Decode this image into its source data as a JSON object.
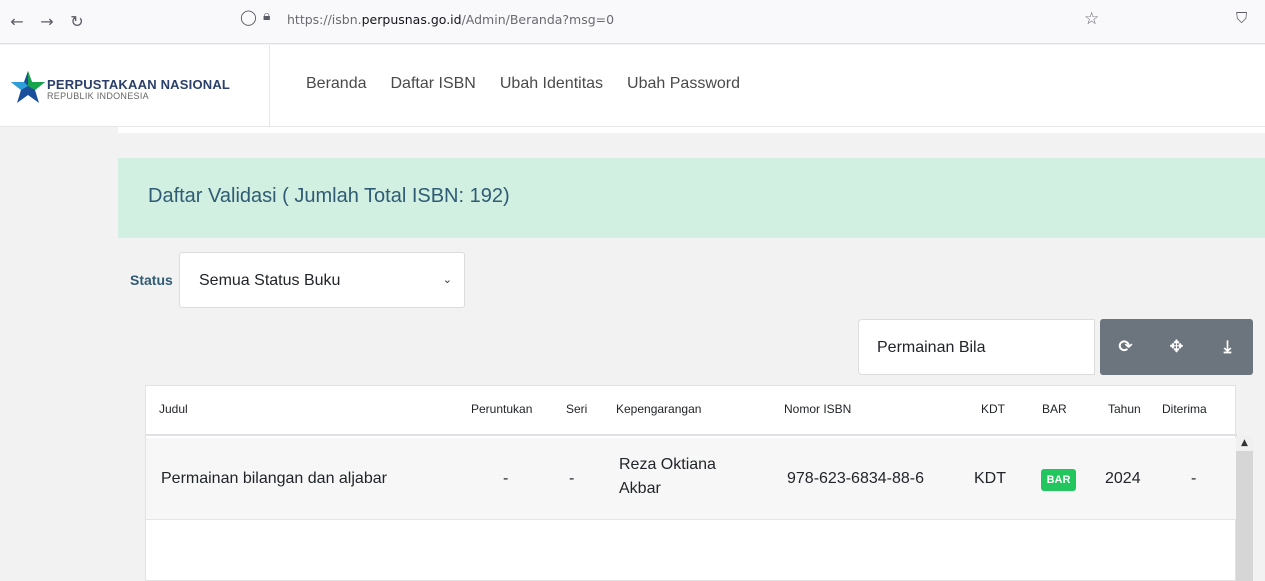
{
  "browser": {
    "url_prefix": "https://isbn.",
    "url_domain": "perpusnas.go.id",
    "url_path": "/Admin/Beranda?msg=0"
  },
  "brand": {
    "title": "PERPUSTAKAAN NASIONAL",
    "subtitle": "REPUBLIK INDONESIA"
  },
  "nav": {
    "items": [
      "Beranda",
      "Daftar ISBN",
      "Ubah Identitas",
      "Ubah Password"
    ]
  },
  "panel": {
    "title": "Daftar Validasi ( Jumlah Total ISBN: 192)"
  },
  "filter": {
    "status_label": "Status",
    "status_value": "Semua Status Buku"
  },
  "search": {
    "value": "Permainan Bila"
  },
  "table": {
    "headers": [
      "Judul",
      "Peruntukan",
      "Seri",
      "Kepengarangan",
      "Nomor ISBN",
      "KDT",
      "BAR",
      "Tahun",
      "Diterima"
    ],
    "rows": [
      {
        "judul": "Permainan bilangan dan aljabar",
        "peruntukan": "-",
        "seri": "-",
        "kepengarangan_1": "Reza Oktiana",
        "kepengarangan_2": "Akbar",
        "isbn": "978-623-6834-88-6",
        "kdt": "KDT",
        "bar": "BAR",
        "tahun": "2024",
        "diterima": "-"
      }
    ]
  },
  "colors": {
    "alert_bg": "#d1f0e1",
    "alert_text": "#2f5b74",
    "toolbar_bg": "#6c757d",
    "bar_badge": "#22c55e"
  }
}
